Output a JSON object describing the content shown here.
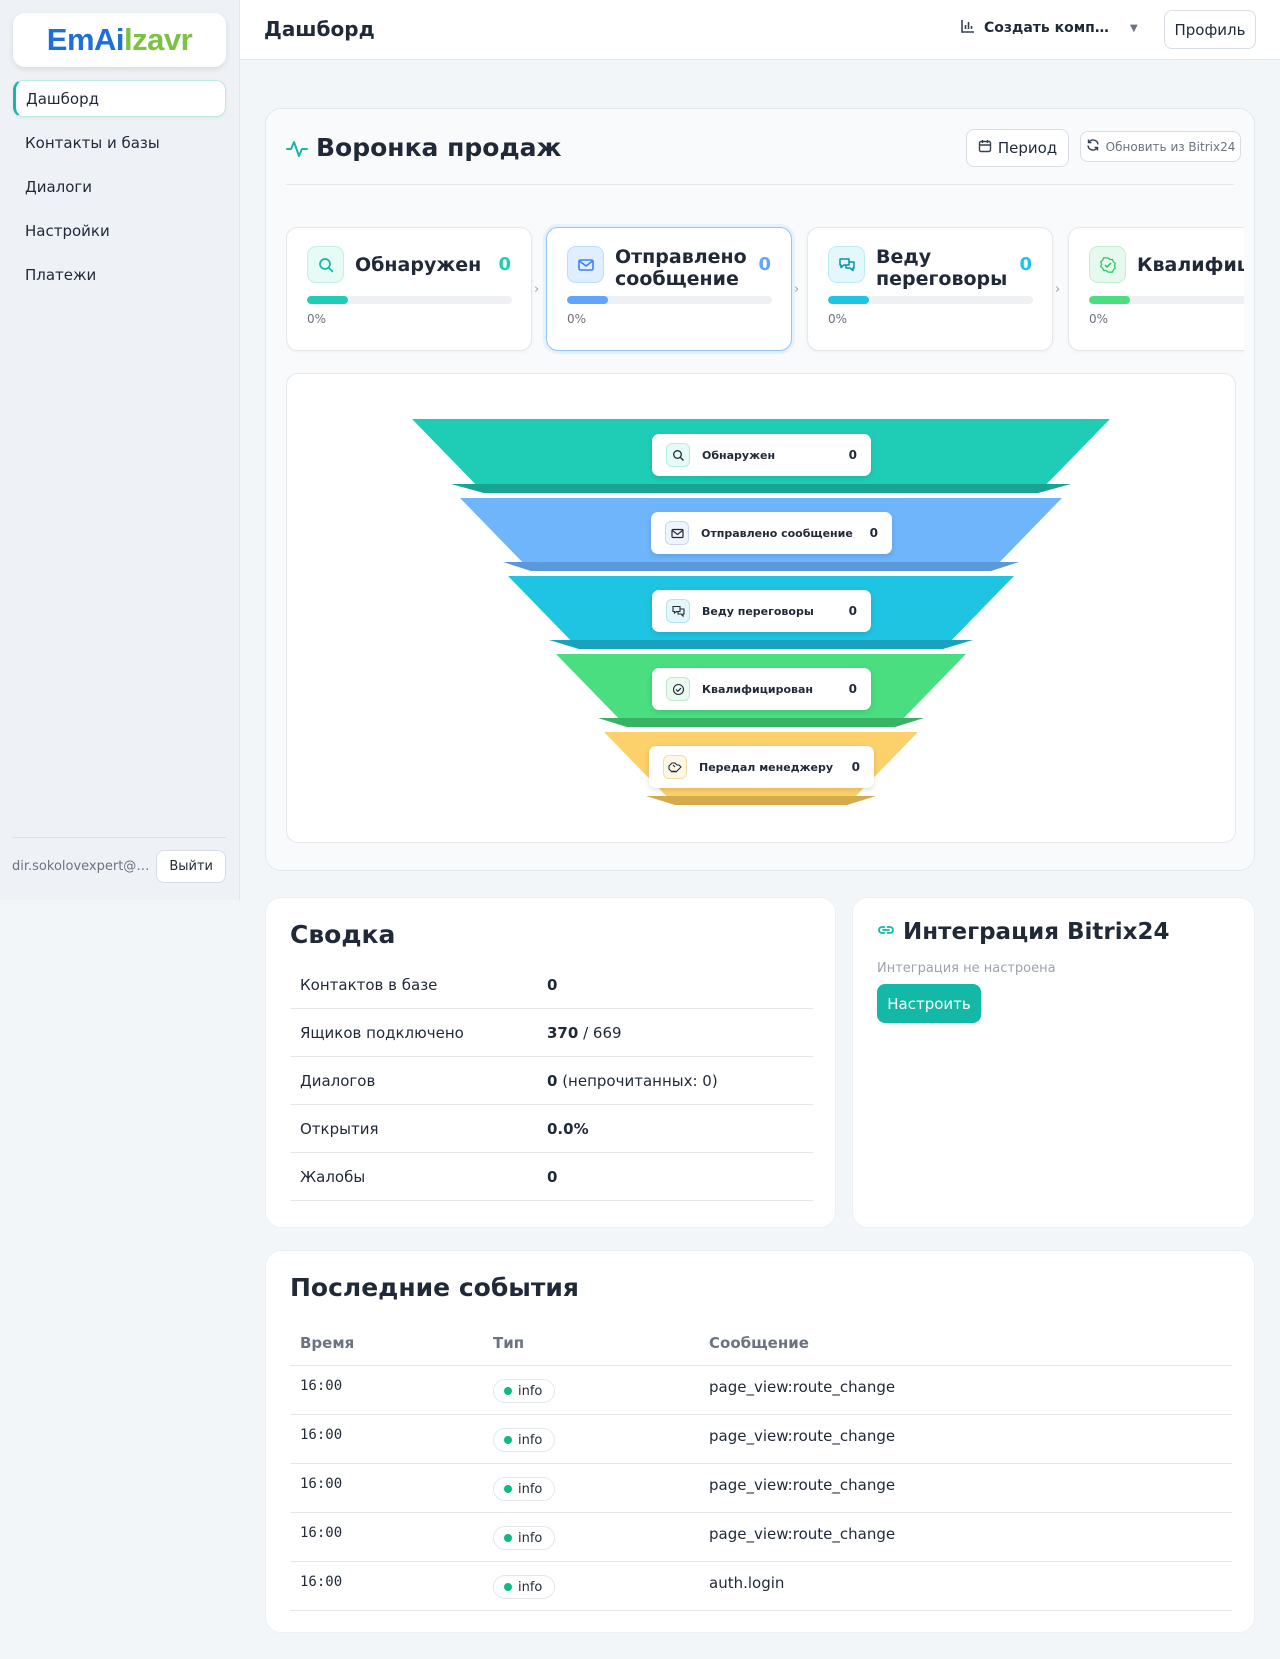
{
  "app": {
    "logo_part1": "EmAi",
    "logo_part2": "lzavr"
  },
  "sidebar": {
    "items": [
      {
        "label": "Дашборд",
        "active": true
      },
      {
        "label": "Контакты и базы",
        "active": false
      },
      {
        "label": "Диалоги",
        "active": false
      },
      {
        "label": "Настройки",
        "active": false
      },
      {
        "label": "Платежи",
        "active": false
      }
    ],
    "user_email": "dir.sokolovexpert@gmail.com",
    "logout_label": "Выйти"
  },
  "topbar": {
    "title": "Дашборд",
    "campaign_label": "Создать компанию",
    "campaign_icon": "bar-chart-icon",
    "profile_label": "Профиль"
  },
  "funnel": {
    "title": "Воронка продаж",
    "period_label": "Период",
    "refresh_label": "Обновить из Bitrix24",
    "stages": [
      {
        "name": "Обнаружен",
        "count": "0",
        "percent": "0%",
        "fill": 0.2,
        "color": "#1fcdb6",
        "icon": "search-icon"
      },
      {
        "name": "Отправлено сообщение",
        "count": "0",
        "percent": "0%",
        "fill": 0.2,
        "color": "#60a5fa",
        "icon": "mail-icon"
      },
      {
        "name": "Веду переговоры",
        "count": "0",
        "percent": "0%",
        "fill": 0.2,
        "color": "#1ec4e1",
        "icon": "chat-icon"
      },
      {
        "name": "Квалифицирован",
        "count": "0",
        "percent": "0%",
        "fill": 0.2,
        "color": "#4ade80",
        "icon": "check-badge-icon"
      },
      {
        "name": "Передал менеджеру",
        "count": "0",
        "percent": "0%",
        "fill": 0.2,
        "color": "#fcd34d",
        "icon": "handshake-icon"
      }
    ]
  },
  "summary": {
    "title": "Сводка",
    "rows": [
      {
        "key": "Контактов в базе",
        "value": "0",
        "extra": ""
      },
      {
        "key": "Ящиков подключено",
        "value": "370",
        "extra": " / 669"
      },
      {
        "key": "Диалогов",
        "value": "0",
        "extra": " (непрочитанных: 0)"
      },
      {
        "key": "Открытия",
        "value": "0.0%",
        "extra": ""
      },
      {
        "key": "Жалобы",
        "value": "0",
        "extra": ""
      }
    ]
  },
  "bitrix": {
    "title": "Интеграция Bitrix24",
    "subtitle": "Интеграция не настроена",
    "setup_label": "Настроить"
  },
  "events": {
    "title": "Последние события",
    "headers": [
      "Время",
      "Тип",
      "Сообщение"
    ],
    "rows": [
      {
        "time": "16:00",
        "type": "info",
        "message": "page_view:route_change"
      },
      {
        "time": "16:00",
        "type": "info",
        "message": "page_view:route_change"
      },
      {
        "time": "16:00",
        "type": "info",
        "message": "page_view:route_change"
      },
      {
        "time": "16:00",
        "type": "info",
        "message": "page_view:route_change"
      },
      {
        "time": "16:00",
        "type": "info",
        "message": "auth.login"
      }
    ]
  }
}
